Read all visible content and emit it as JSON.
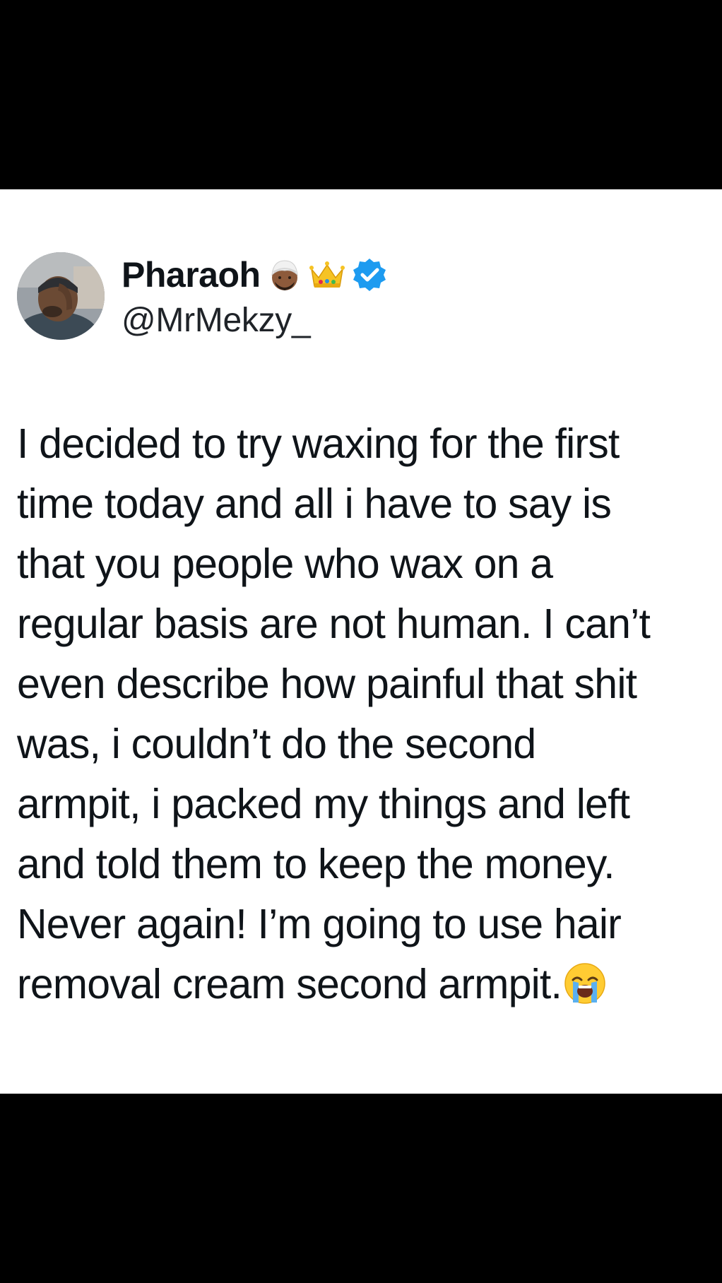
{
  "tweet": {
    "author": {
      "display_name": "Pharaoh",
      "handle": "@MrMekzy_",
      "name_emojis": [
        "man-with-turban-icon",
        "crown-icon"
      ],
      "verified": true,
      "verified_color": "#1d9bf0"
    },
    "text_lines": [
      "I decided to try waxing for the first",
      "time today and all i have to say is",
      "that you people who wax on a",
      "regular basis are not human. I can’t",
      "even describe how painful that shit",
      "was, i couldn’t do the second",
      "armpit, i packed my things and left",
      "and told them to keep the money.",
      "Never again! I’m going to use hair",
      "removal cream second armpit."
    ],
    "trailing_emoji": "loudly-crying-face-icon"
  },
  "colors": {
    "background": "#000000",
    "card": "#ffffff",
    "text": "#0f1419"
  }
}
